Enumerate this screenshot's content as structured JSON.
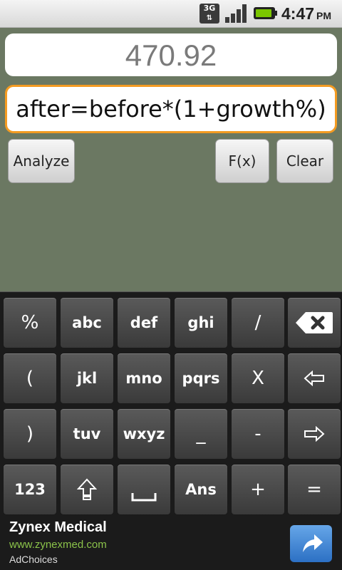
{
  "status": {
    "network": "3G",
    "time": "4:47",
    "ampm": "PM",
    "battery_color": "#7bc600"
  },
  "display": {
    "result": "470.92",
    "formula": "after=before*(1+growth%)",
    "formula_border_color": "#f39b22"
  },
  "buttons": {
    "analyze": "Analyze",
    "fx": "F(x)",
    "clear": "Clear"
  },
  "keypad": {
    "rows": [
      [
        "%",
        "abc",
        "def",
        "ghi",
        "/",
        "backspace-icon"
      ],
      [
        "(",
        "jkl",
        "mno",
        "pqrs",
        "X",
        "arrow-left-icon"
      ],
      [
        ")",
        "tuv",
        "wxyz",
        "_",
        "-",
        "arrow-right-icon"
      ],
      [
        "123",
        "shift-icon",
        "space-icon",
        "Ans",
        "+",
        "="
      ]
    ]
  },
  "ad": {
    "title": "Zynex Medical",
    "url": "www.zynexmed.com",
    "choices": "AdChoices",
    "button_icon": "share-arrow-icon",
    "url_color": "#8bc34a"
  }
}
